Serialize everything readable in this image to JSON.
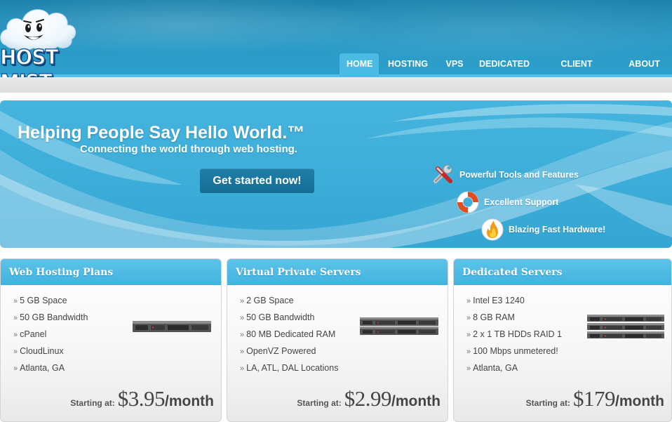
{
  "brand": {
    "name": "HOST MIST"
  },
  "nav": {
    "items": [
      {
        "label": "HOME",
        "active": true
      },
      {
        "label": "HOSTING",
        "active": false
      },
      {
        "label": "VPS",
        "active": false
      },
      {
        "label": "DEDICATED",
        "active": false
      },
      {
        "label": "CLIENT CENTER",
        "active": false
      },
      {
        "label": "ABOUT US",
        "active": false
      }
    ]
  },
  "banner": {
    "title": "Helping People Say Hello World.™",
    "subtitle": "Connecting the world through web hosting.",
    "cta_label": "Get started now!",
    "features": [
      {
        "icon": "tools-icon",
        "label": "Powerful Tools and Features"
      },
      {
        "icon": "lifebuoy-icon",
        "label": "Excellent Support"
      },
      {
        "icon": "flame-icon",
        "label": "Blazing Fast Hardware!"
      }
    ]
  },
  "plans": [
    {
      "title": "Web Hosting Plans",
      "features": [
        "5 GB Space",
        "50 GB Bandwidth",
        "cPanel",
        "CloudLinux",
        "Atlanta, GA"
      ],
      "price_label": "Starting at:",
      "price": "$3.95",
      "period": "/month"
    },
    {
      "title": "Virtual Private Servers",
      "features": [
        "2 GB Space",
        "50 GB Bandwidth",
        "80 MB Dedicated RAM",
        "OpenVZ Powered",
        "LA, ATL, DAL Locations"
      ],
      "price_label": "Starting at:",
      "price": "$2.99",
      "period": "/month"
    },
    {
      "title": "Dedicated Servers",
      "features": [
        "Intel E3 1240",
        "8 GB RAM",
        "2 x 1 TB HDDs RAID 1",
        "100 Mbps unmetered!",
        "Atlanta, GA"
      ],
      "price_label": "Starting at:",
      "price": "$179",
      "period": "/month"
    }
  ],
  "colors": {
    "header_blue": "#2a9ac6",
    "banner_blue": "#3eaedb",
    "card_header": "#4fbbe3",
    "cta": "#1a76a0"
  }
}
